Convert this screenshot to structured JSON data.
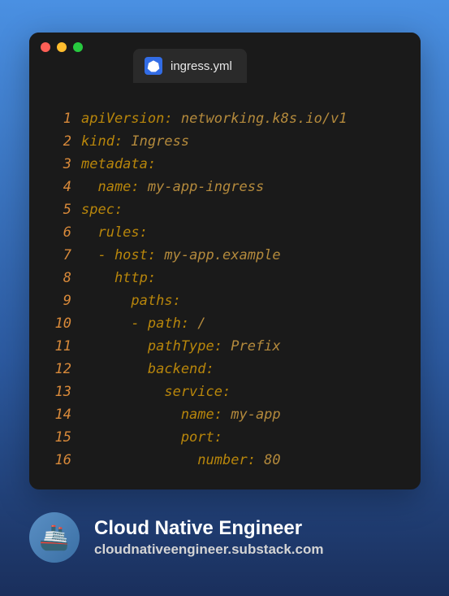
{
  "tab": {
    "filename": "ingress.yml",
    "icon": "kubernetes-icon"
  },
  "window": {
    "dots": [
      "close",
      "minimize",
      "zoom"
    ]
  },
  "code": {
    "lines": [
      {
        "n": "1",
        "key": "apiVersion: ",
        "val": "networking.k8s.io/v1"
      },
      {
        "n": "2",
        "key": "kind: ",
        "val": "Ingress"
      },
      {
        "n": "3",
        "key": "metadata:",
        "val": ""
      },
      {
        "n": "4",
        "key": "  name: ",
        "val": "my-app-ingress"
      },
      {
        "n": "5",
        "key": "spec:",
        "val": ""
      },
      {
        "n": "6",
        "key": "  rules:",
        "val": ""
      },
      {
        "n": "7",
        "key": "  - host: ",
        "val": "my-app.example"
      },
      {
        "n": "8",
        "key": "    http:",
        "val": ""
      },
      {
        "n": "9",
        "key": "      paths:",
        "val": ""
      },
      {
        "n": "10",
        "key": "      - path: ",
        "val": "/"
      },
      {
        "n": "11",
        "key": "        pathType: ",
        "val": "Prefix"
      },
      {
        "n": "12",
        "key": "        backend:",
        "val": ""
      },
      {
        "n": "13",
        "key": "          service:",
        "val": ""
      },
      {
        "n": "14",
        "key": "            name: ",
        "val": "my-app"
      },
      {
        "n": "15",
        "key": "            port:",
        "val": ""
      },
      {
        "n": "16",
        "key": "              number: ",
        "val": "80"
      }
    ]
  },
  "footer": {
    "title": "Cloud Native Engineer",
    "url": "cloudnativeengineer.substack.com",
    "avatar_emoji": "🚢"
  }
}
